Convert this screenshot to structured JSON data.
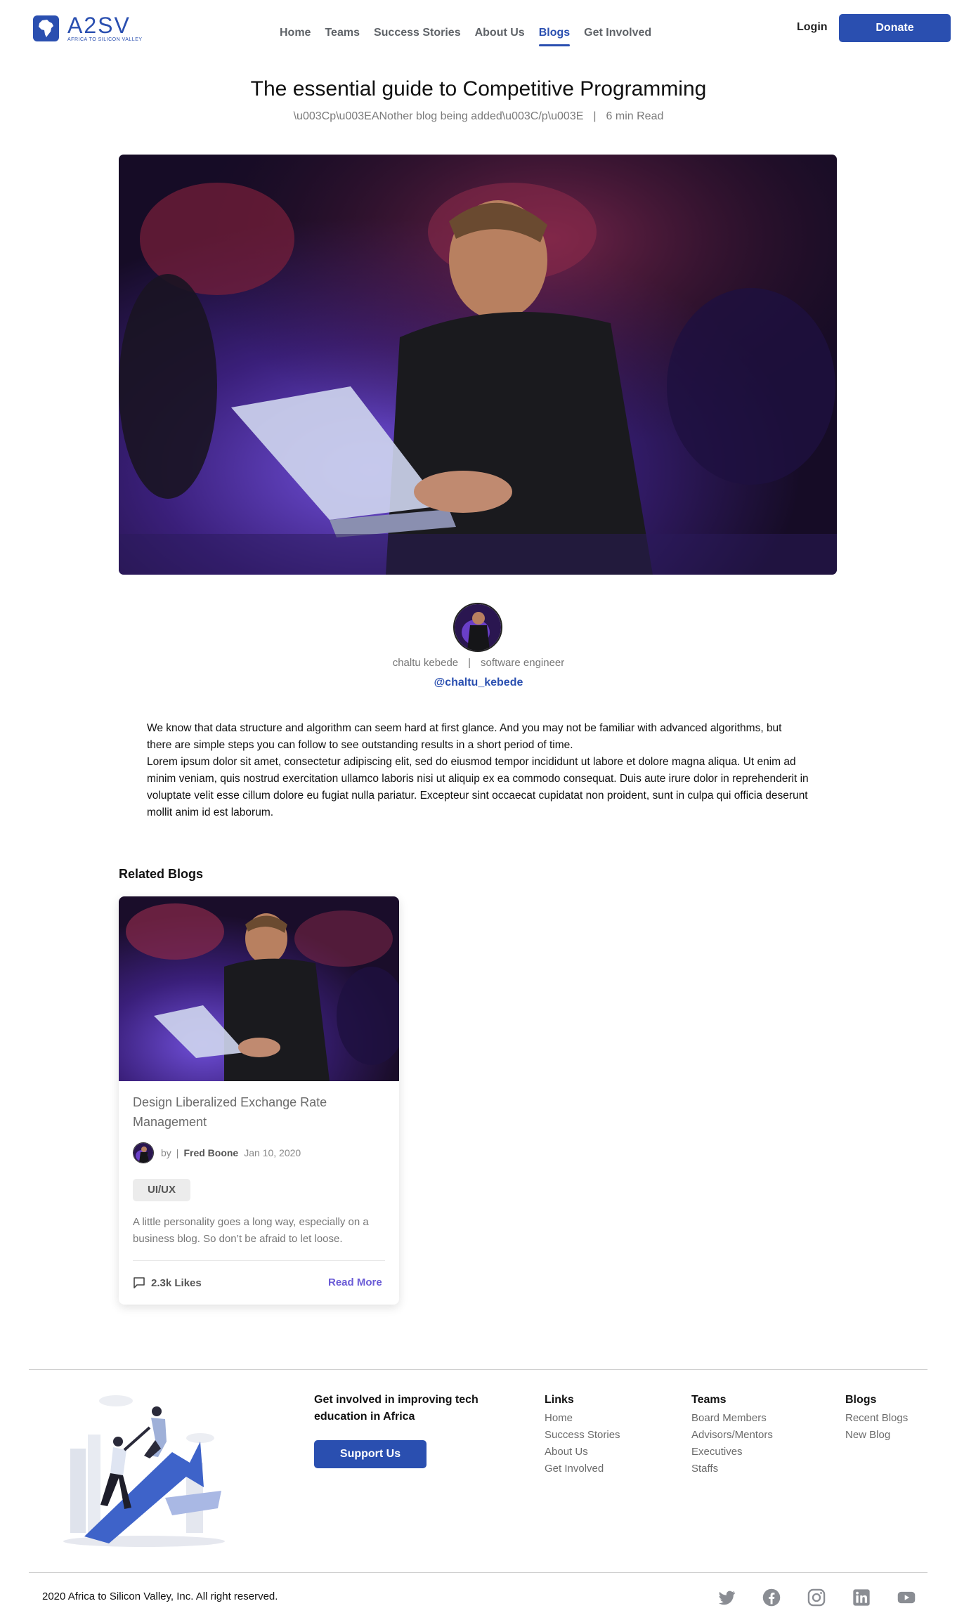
{
  "header": {
    "logo_text": "A2SV",
    "logo_tagline": "AFRICA TO SILICON VALLEY",
    "nav": [
      {
        "label": "Home",
        "active": false
      },
      {
        "label": "Teams",
        "active": false
      },
      {
        "label": "Success Stories",
        "active": false
      },
      {
        "label": "About Us",
        "active": false
      },
      {
        "label": "Blogs",
        "active": true
      },
      {
        "label": "Get Involved",
        "active": false
      }
    ],
    "login_label": "Login",
    "donate_label": "Donate"
  },
  "article": {
    "title": "The essential guide to Competitive Programming",
    "subtitle": "\\u003Cp\\u003EANother blog being added\\u003C/p\\u003E",
    "read_time": "6 min Read",
    "author_name": "chaltu kebede",
    "author_role": "software engineer",
    "author_handle": "@chaltu_kebede",
    "body": [
      "We know that data structure and algorithm can seem hard at first glance. And you may not be familiar with advanced algorithms, but there are simple steps you can follow to see outstanding results in a short period of time.",
      "Lorem ipsum dolor sit amet, consectetur adipiscing elit, sed do eiusmod tempor incididunt ut labore et dolore magna aliqua. Ut enim ad minim veniam, quis nostrud exercitation ullamco laboris nisi ut aliquip ex ea commodo consequat. Duis aute irure dolor in reprehenderit in voluptate velit esse cillum dolore eu fugiat nulla pariatur. Excepteur sint occaecat cupidatat non proident, sunt in culpa qui officia deserunt mollit anim id est laborum."
    ]
  },
  "related": {
    "heading": "Related Blogs",
    "cards": [
      {
        "title": "Design Liberalized Exchange Rate Management",
        "by": "by",
        "author": "Fred Boone",
        "date": "Jan 10, 2020",
        "tag": "UI/UX",
        "excerpt": "A little personality goes a long way, especially on a business blog. So don’t be afraid to let loose.",
        "likes": "2.3k Likes",
        "read_more": "Read More"
      }
    ]
  },
  "footer": {
    "cta": "Get involved in improving tech education in Africa",
    "support_label": "Support Us",
    "columns": [
      {
        "heading": "Links",
        "items": [
          "Home",
          "Success Stories",
          "About Us",
          "Get Involved"
        ]
      },
      {
        "heading": "Teams",
        "items": [
          "Board Members",
          "Advisors/Mentors",
          "Executives",
          "Staffs"
        ]
      },
      {
        "heading": "Blogs",
        "items": [
          "Recent Blogs",
          "New Blog"
        ]
      }
    ],
    "copyright": "2020 Africa to Silicon Valley, Inc. All right reserved.",
    "socials": [
      "twitter-icon",
      "facebook-icon",
      "instagram-icon",
      "linkedin-icon",
      "youtube-icon"
    ]
  },
  "colors": {
    "brand": "#2a4fb0",
    "read_more": "#6a5bd6",
    "muted_text": "#6b6b6b"
  }
}
